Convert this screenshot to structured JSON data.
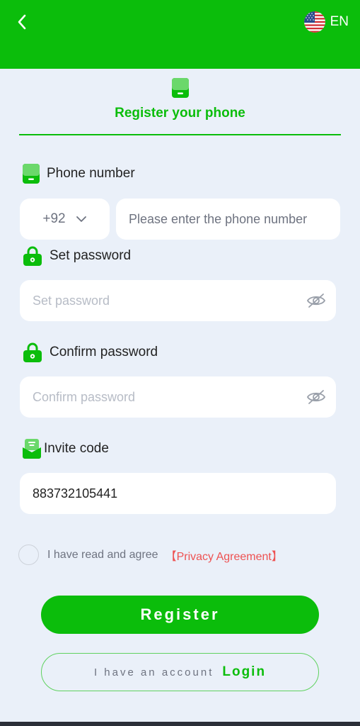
{
  "header": {
    "language": "EN"
  },
  "tab": {
    "title": "Register your phone"
  },
  "phone": {
    "label": "Phone number",
    "country_code": "+92",
    "placeholder": "Please enter the phone number",
    "value": ""
  },
  "password": {
    "label": "Set password",
    "placeholder": "Set password",
    "value": ""
  },
  "confirm": {
    "label": "Confirm password",
    "placeholder": "Confirm password",
    "value": ""
  },
  "invite": {
    "label": "Invite code",
    "value": "883732105441"
  },
  "agreement": {
    "text": "I have read and agree",
    "link": "【Privacy Agreement】",
    "checked": false
  },
  "actions": {
    "register_label": "Register",
    "login_prefix": "I have an account",
    "login_label": "Login"
  },
  "colors": {
    "primary": "#0bbd0b",
    "background": "#eaf0f9",
    "link_red": "#ee5252"
  },
  "icons": {
    "back": "chevron-left-icon",
    "flag": "us-flag-icon",
    "phone": "phone-icon",
    "lock": "lock-icon",
    "eye": "eye-off-icon",
    "invite": "invite-icon",
    "dropdown": "chevron-down-icon"
  }
}
